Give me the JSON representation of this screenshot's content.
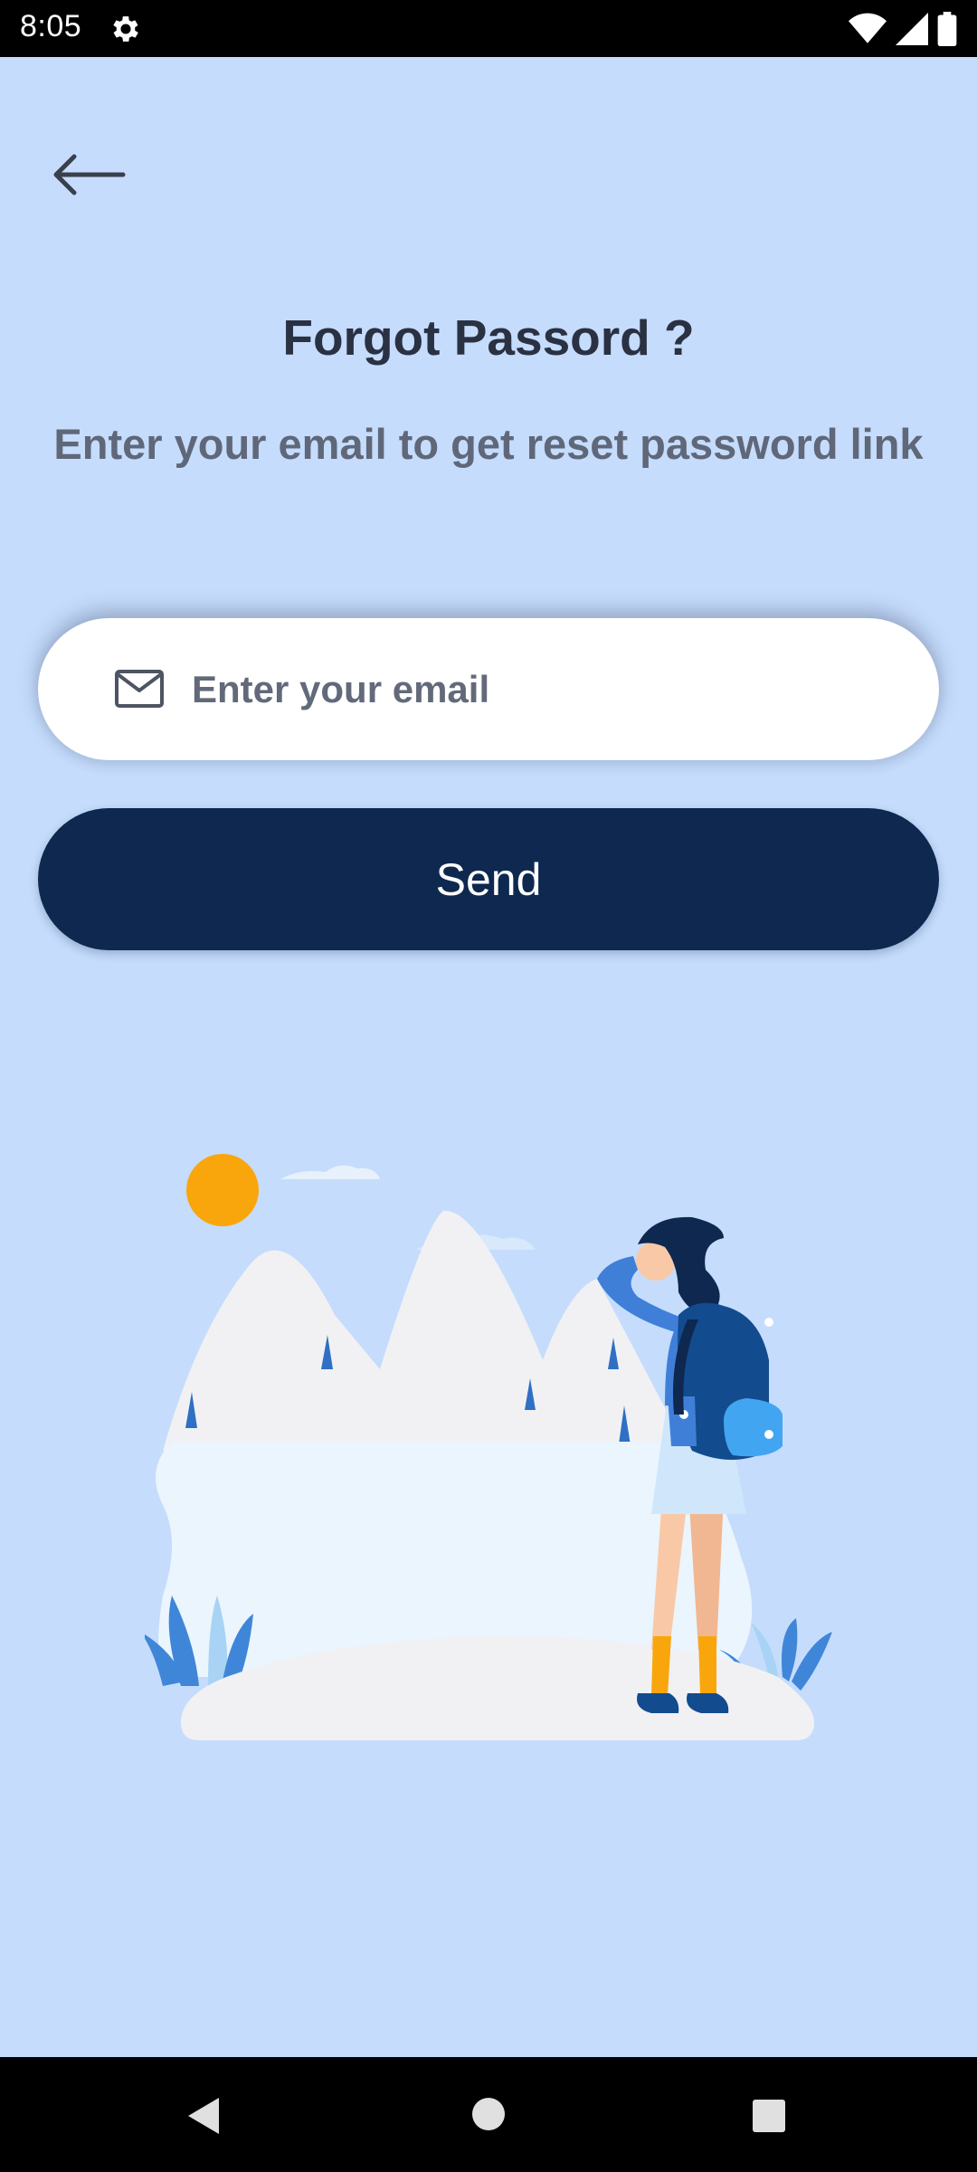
{
  "status_bar": {
    "time": "8:05",
    "icons": [
      "gear-icon",
      "wifi-icon",
      "signal-icon",
      "battery-icon"
    ]
  },
  "header": {
    "back_icon": "arrow-left-icon"
  },
  "page": {
    "title": "Forgot Passord ?",
    "subtitle": "Enter your email to get reset password link"
  },
  "form": {
    "email_icon": "mail-icon",
    "email_placeholder": "Enter your email",
    "email_value": "",
    "send_label": "Send"
  },
  "navigation_bar": {
    "icons": [
      "back-triangle-icon",
      "home-circle-icon",
      "recents-square-icon"
    ]
  },
  "colors": {
    "background": "#c5dcfc",
    "primary_button": "#0e2850",
    "title_text": "#2a3142",
    "subtitle_text": "#5f6779",
    "sun": "#f9a60d"
  }
}
